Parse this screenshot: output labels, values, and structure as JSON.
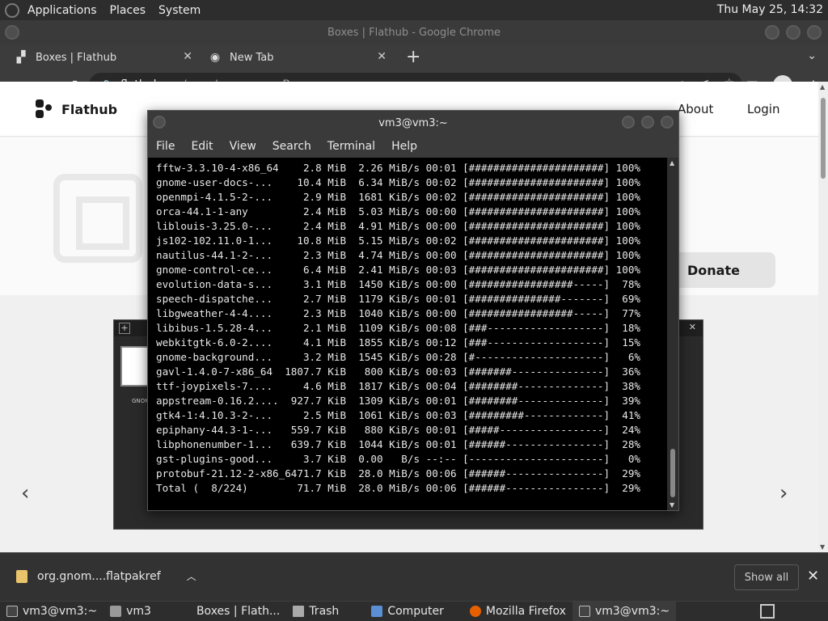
{
  "top_panel": {
    "menus": [
      "Applications",
      "Places",
      "System"
    ],
    "clock": "Thu May 25, 14:32"
  },
  "chrome": {
    "window_title": "Boxes | Flathub - Google Chrome",
    "tabs": [
      {
        "label": "Boxes | Flathub",
        "active": true
      },
      {
        "label": "New Tab",
        "active": false
      }
    ],
    "url_host": "flathub.org",
    "url_path": "/apps/org.gnome.Boxes"
  },
  "page": {
    "brand": "Flathub",
    "nav_about": "About",
    "nav_login": "Login",
    "donate": "Donate",
    "thumb_label": "GNOM"
  },
  "downloads": {
    "file_name": "org.gnom....flatpakref",
    "show_all": "Show all"
  },
  "terminal": {
    "title": "vm3@vm3:~",
    "menu": [
      "File",
      "Edit",
      "View",
      "Search",
      "Terminal",
      "Help"
    ],
    "lines": [
      "fftw-3.3.10-4-x86_64    2.8 MiB  2.26 MiB/s 00:01 [######################] 100%",
      "gnome-user-docs-...    10.4 MiB  6.34 MiB/s 00:02 [######################] 100%",
      "openmpi-4.1.5-2-...     2.9 MiB  1681 KiB/s 00:02 [######################] 100%",
      "orca-44.1-1-any         2.4 MiB  5.03 MiB/s 00:00 [######################] 100%",
      "liblouis-3.25.0-...     2.4 MiB  4.91 MiB/s 00:00 [######################] 100%",
      "js102-102.11.0-1...    10.8 MiB  5.15 MiB/s 00:02 [######################] 100%",
      "nautilus-44.1-2-...     2.3 MiB  4.74 MiB/s 00:00 [######################] 100%",
      "gnome-control-ce...     6.4 MiB  2.41 MiB/s 00:03 [######################] 100%",
      "evolution-data-s...     3.1 MiB  1450 KiB/s 00:00 [#################-----]  78%",
      "speech-dispatche...     2.7 MiB  1179 KiB/s 00:01 [###############-------]  69%",
      "libgweather-4-4....     2.3 MiB  1040 KiB/s 00:00 [#################-----]  77%",
      "libibus-1.5.28-4...     2.1 MiB  1109 KiB/s 00:08 [###-------------------]  18%",
      "webkitgtk-6.0-2....     4.1 MiB  1855 KiB/s 00:12 [###-------------------]  15%",
      "gnome-background...     3.2 MiB  1545 KiB/s 00:28 [#---------------------]   6%",
      "gavl-1.4.0-7-x86_64  1807.7 KiB   800 KiB/s 00:03 [#######---------------]  36%",
      "ttf-joypixels-7....     4.6 MiB  1817 KiB/s 00:04 [########--------------]  38%",
      "appstream-0.16.2....  927.7 KiB  1309 KiB/s 00:01 [########--------------]  39%",
      "gtk4-1:4.10.3-2-...     2.5 MiB  1061 KiB/s 00:03 [#########-------------]  41%",
      "epiphany-44.3-1-...   559.7 KiB   880 KiB/s 00:01 [#####-----------------]  24%",
      "libphonenumber-1...   639.7 KiB  1044 KiB/s 00:01 [######----------------]  28%",
      "gst-plugins-good...     3.7 KiB  0.00   B/s --:-- [----------------------]   0%",
      "protobuf-21.12-2-x86_6471.7 KiB  28.0 MiB/s 00:06 [######----------------]  29%",
      "Total (  8/224)        71.7 MiB  28.0 MiB/s 00:06 [######----------------]  29%"
    ]
  },
  "taskbar": {
    "items": [
      {
        "label": "vm3@vm3:~",
        "icon": "terminal-icon"
      },
      {
        "label": "vm3",
        "icon": "folder-icon"
      },
      {
        "label": "Boxes | Flath...",
        "icon": "chrome-icon"
      },
      {
        "label": "Trash",
        "icon": "trash-icon"
      },
      {
        "label": "Computer",
        "icon": "computer-icon"
      },
      {
        "label": "Mozilla Firefox",
        "icon": "firefox-icon"
      },
      {
        "label": "vm3@vm3:~",
        "icon": "terminal-icon"
      }
    ]
  }
}
